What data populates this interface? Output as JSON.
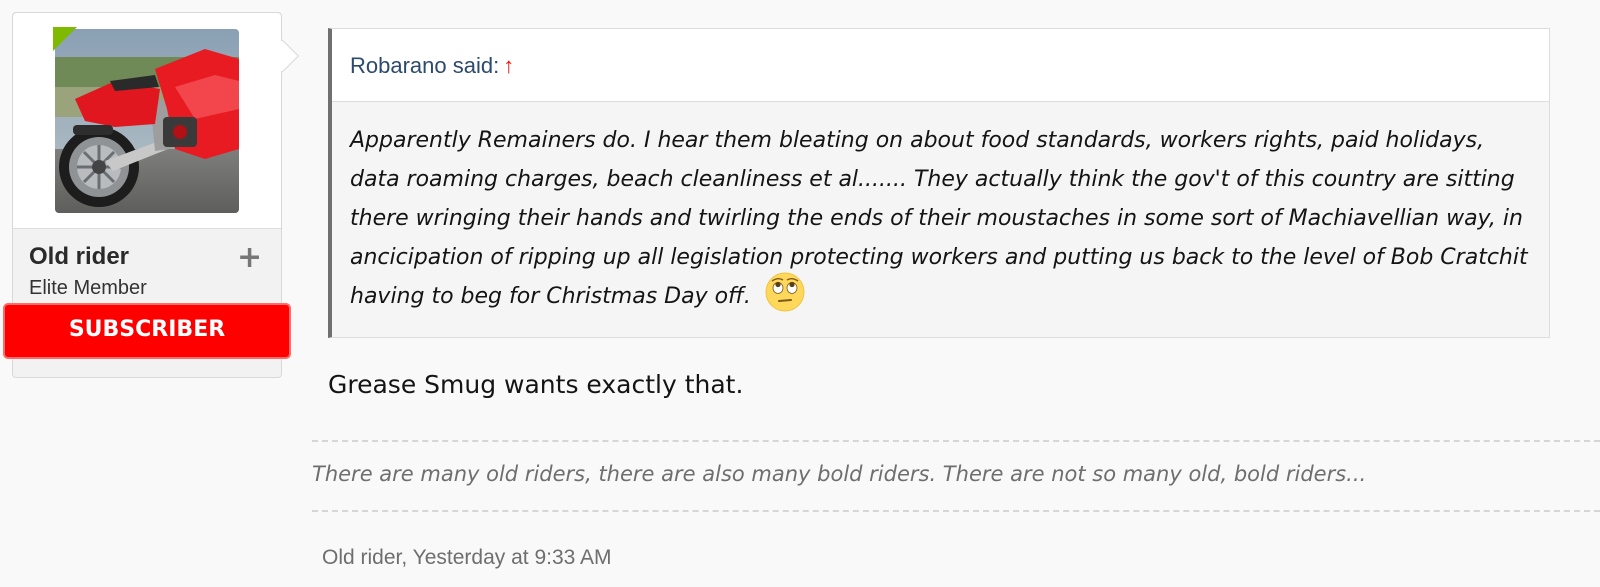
{
  "user": {
    "name": "Old rider",
    "title": "Elite Member",
    "banner": "SUBSCRIBER",
    "plus_icon": "plus-icon",
    "online_color": "#7fb900",
    "avatar_icon": "red-motorcycle-avatar"
  },
  "quote": {
    "author": "Robarano said:",
    "jump_icon": "↑",
    "text": "Apparently Remainers do. I hear them bleating on about food standards, workers rights, paid holidays, data roaming charges, beach cleanliness et al....... They actually think the gov't of this country are sitting there wringing their hands and twirling the ends of their moustaches in some sort of Machiavellian way, in ancicipation of ripping up all legislation protecting workers and putting us back to the level of Bob Cratchit having to beg for Christmas Day off.",
    "emoji": "eye-roll-emoji"
  },
  "post": {
    "text": "Grease Smug wants exactly that."
  },
  "signature": {
    "text": "There are many old riders, there are also many bold riders. There are not so many old, bold riders..."
  },
  "meta": {
    "author_time": "Old rider, Yesterday at 9:33 AM"
  },
  "colors": {
    "banner": "#ff0000",
    "quote_author": "#2c4a6e",
    "jump_arrow": "#ee1111"
  }
}
